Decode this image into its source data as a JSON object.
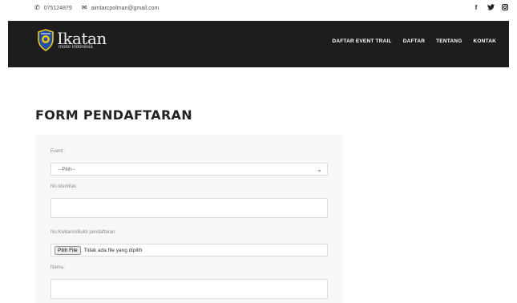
{
  "topbar": {
    "phone_icon": "phone-icon",
    "phone": "075124879",
    "email_icon": "envelope-icon",
    "email": "aimtarcpolman@gmail.com",
    "social": [
      {
        "icon": "facebook-icon",
        "glyph": "f"
      },
      {
        "icon": "twitter-icon",
        "glyph": "𝕥"
      },
      {
        "icon": "instagram-icon",
        "glyph": "▣"
      }
    ]
  },
  "header": {
    "logo_title": "Ikatan",
    "logo_subtitle": "motor indonesia",
    "nav": [
      "DAFTAR EVENT TRAIL",
      "DAFTAR",
      "TENTANG",
      "KONTAK"
    ]
  },
  "page": {
    "title": "FORM PENDAFTARAN"
  },
  "form": {
    "event_label": "Event :",
    "event_value": "--Pilih--",
    "identity_label": "No.Identitas :",
    "identity_value": "",
    "receipt_label": "No.Kwitansi/Bukti pendaftaran :",
    "file_button": "Pilih File",
    "file_status": "Tidak ada file yang dipilih",
    "name_label": "Nama :",
    "name_value": ""
  },
  "colors": {
    "header_bg": "#1d1d1d",
    "panel_bg": "#f7f7f7",
    "nav_text": "#ffffff"
  }
}
